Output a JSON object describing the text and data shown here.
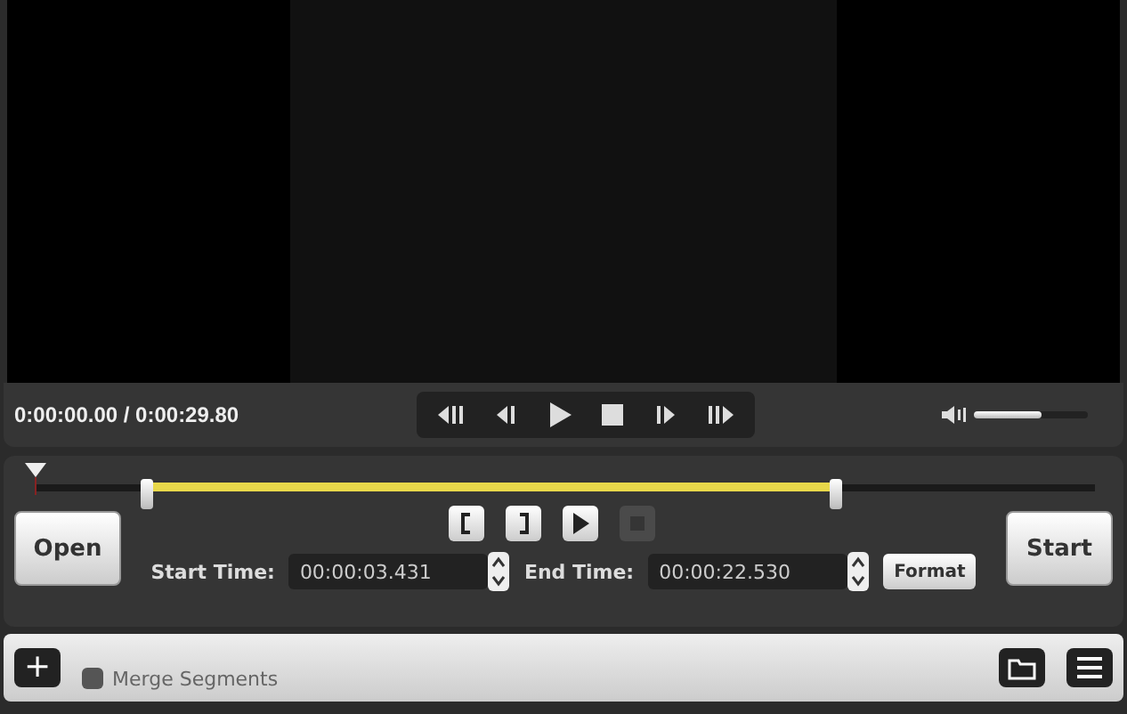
{
  "player": {
    "time": "0:00:00.00 / 0:00:29.80",
    "volume": {
      "level": 0.6
    }
  },
  "timeline": {
    "playhead": {
      "level": 0.0
    },
    "selection_start": {
      "level": 0.105
    },
    "selection_end": {
      "level": 0.755
    }
  },
  "open_button": "Open",
  "start_time": {
    "label": "Start Time:",
    "value": "00:00:03.431"
  },
  "end_time": {
    "label": "End Time:",
    "value": "00:00:22.530"
  },
  "format_button": "Format",
  "start_button": "Start",
  "segment_buttons": [
    {
      "kind": "mark-in",
      "disabled": false
    },
    {
      "kind": "mark-out",
      "disabled": false
    },
    {
      "kind": "play-segment",
      "disabled": false
    },
    {
      "kind": "stop",
      "disabled": true
    }
  ],
  "add_button": "+",
  "merge_segments": {
    "label": "Merge Segments",
    "checked": false
  }
}
